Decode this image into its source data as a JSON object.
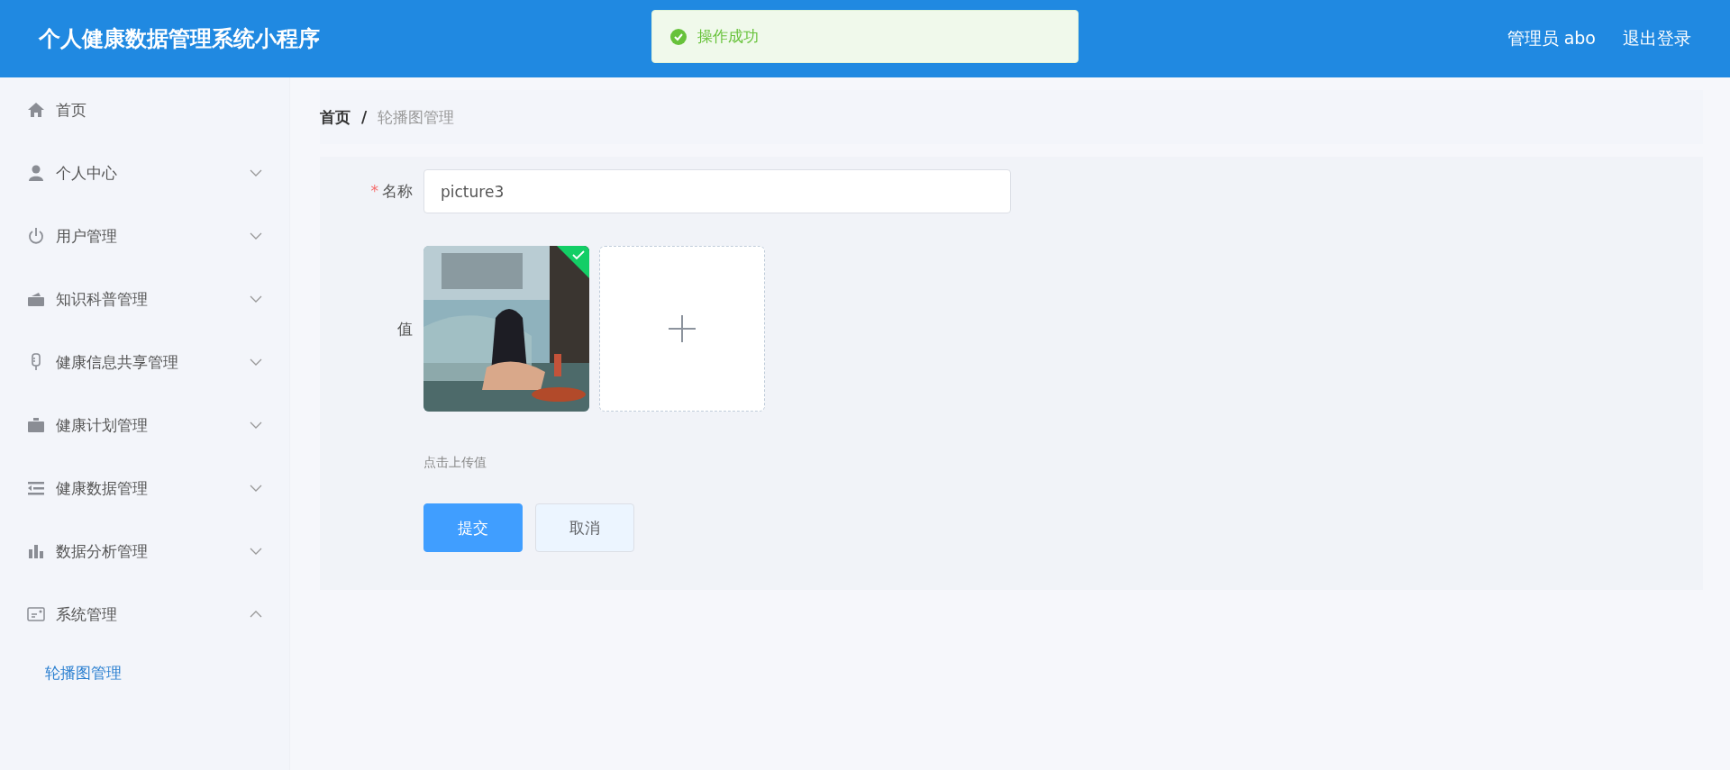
{
  "header": {
    "title": "个人健康数据管理系统小程序",
    "user": "管理员 abo",
    "logout": "退出登录"
  },
  "toast": {
    "kind": "success",
    "message": "操作成功"
  },
  "sidebar": {
    "items": [
      {
        "label": "首页"
      },
      {
        "label": "个人中心",
        "expanded": false
      },
      {
        "label": "用户管理",
        "expanded": false
      },
      {
        "label": "知识科普管理",
        "expanded": false
      },
      {
        "label": "健康信息共享管理",
        "expanded": false
      },
      {
        "label": "健康计划管理",
        "expanded": false
      },
      {
        "label": "健康数据管理",
        "expanded": false
      },
      {
        "label": "数据分析管理",
        "expanded": false
      },
      {
        "label": "系统管理",
        "expanded": true,
        "children": [
          {
            "label": "轮播图管理",
            "selected": true
          }
        ]
      }
    ]
  },
  "breadcrumb": {
    "items": [
      "首页",
      "轮播图管理"
    ],
    "separator": "/"
  },
  "form": {
    "fields": [
      {
        "kind": "text",
        "label": "名称",
        "required_mark": "*",
        "value": "picture3"
      },
      {
        "kind": "upload",
        "label": "值",
        "files": [
          {
            "kind": "picture",
            "uploaded": true
          }
        ],
        "hint": "点击上传值"
      }
    ],
    "buttons": [
      {
        "label": "提交",
        "kind": "primary"
      },
      {
        "label": "取消",
        "kind": "default"
      }
    ]
  }
}
